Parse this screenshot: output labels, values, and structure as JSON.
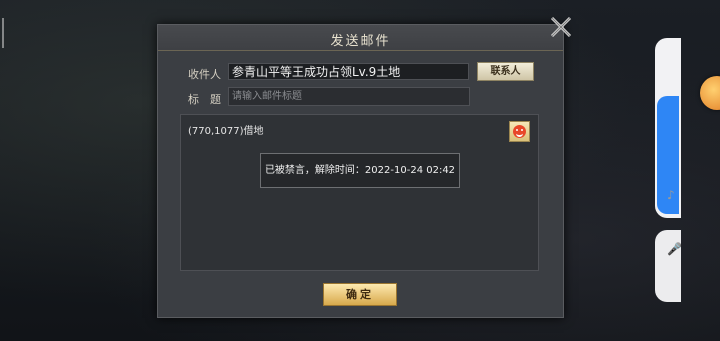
{
  "dialog": {
    "title": "发送邮件",
    "recipient_label": "收件人",
    "recipient_value": "参青山平等王成功占领Lv.9土地",
    "contact_button": "联系人",
    "subject_label": "标　题",
    "subject_placeholder": "请输入邮件标题",
    "body_text": "(770,1077)借地",
    "confirm_button": "确定"
  },
  "toast": {
    "message": "已被禁言，解除时间：2022-10-24 02:42"
  },
  "colors": {
    "dialog_bg": "#3b3e43",
    "confirm_gold": "#d8a94c",
    "side_blue": "#2e86f5"
  },
  "icons": [
    "close-icon",
    "emoji-icon",
    "music-icon",
    "mic-icon",
    "game-float-icon"
  ]
}
